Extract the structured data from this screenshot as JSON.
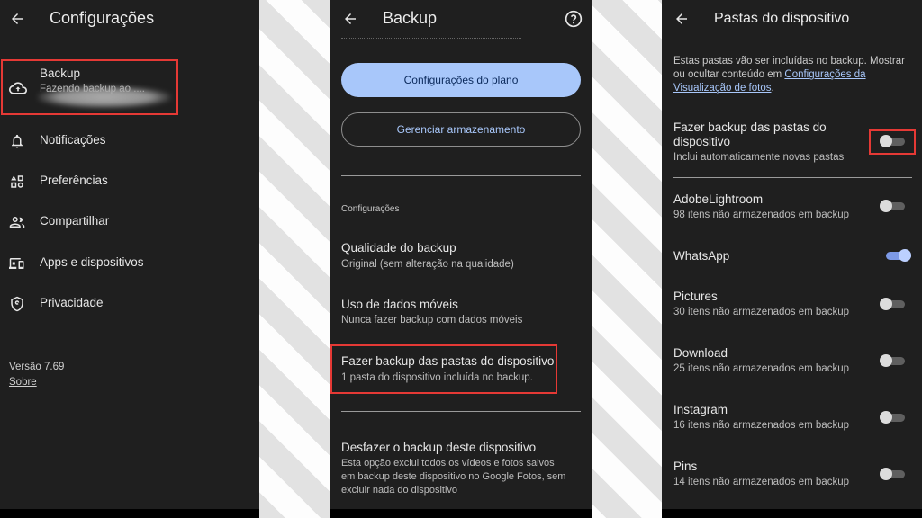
{
  "panel1": {
    "title": "Configurações",
    "backup": {
      "label": "Backup",
      "subtitle": "Fazendo backup ao ...."
    },
    "menu": [
      {
        "label": "Notificações",
        "icon": "bell-icon"
      },
      {
        "label": "Preferências",
        "icon": "preferences-icon"
      },
      {
        "label": "Compartilhar",
        "icon": "people-icon"
      },
      {
        "label": "Apps e dispositivos",
        "icon": "devices-icon"
      },
      {
        "label": "Privacidade",
        "icon": "privacy-shield-icon"
      }
    ],
    "version": "Versão 7.69",
    "about": "Sobre"
  },
  "panel2": {
    "title": "Backup",
    "plan_button": "Configurações do plano",
    "storage_button": "Gerenciar armazenamento",
    "section_header": "Configurações",
    "quality": {
      "title": "Qualidade do backup",
      "subtitle": "Original (sem alteração na qualidade)"
    },
    "mobile_data": {
      "title": "Uso de dados móveis",
      "subtitle": "Nunca fazer backup com dados móveis"
    },
    "device_folders": {
      "title": "Fazer backup das pastas do dispositivo",
      "subtitle": "1 pasta do dispositivo incluída no backup."
    },
    "undo": {
      "title": "Desfazer o backup deste dispositivo",
      "line1": "Esta opção exclui todos os vídeos e fotos salvos",
      "line2": "em backup deste dispositivo no Google Fotos, sem",
      "line3": "excluir nada do dispositivo"
    }
  },
  "panel3": {
    "title": "Pastas do dispositivo",
    "info_line1": "Estas pastas vão ser incluídas no backup. Mostrar",
    "info_line2_prefix": "ou ocultar conteúdo em ",
    "info_link1": "Configurações da",
    "info_link2": "Visualização de fotos",
    "info_suffix": ".",
    "master": {
      "title_line1": "Fazer backup das pastas do",
      "title_line2": "dispositivo",
      "subtitle": "Inclui automaticamente novas pastas",
      "enabled": false
    },
    "folders": [
      {
        "name": "AdobeLightroom",
        "subtitle": "98 itens não armazenados em backup",
        "enabled": false
      },
      {
        "name": "WhatsApp",
        "subtitle": "",
        "enabled": true
      },
      {
        "name": "Pictures",
        "subtitle": "30 itens não armazenados em backup",
        "enabled": false
      },
      {
        "name": "Download",
        "subtitle": "25 itens não armazenados em backup",
        "enabled": false
      },
      {
        "name": "Instagram",
        "subtitle": "16 itens não armazenados em backup",
        "enabled": false
      },
      {
        "name": "Pins",
        "subtitle": "14 itens não armazenados em backup",
        "enabled": false
      }
    ]
  },
  "colors": {
    "panel_bg": "#1f1f1f",
    "accent": "#a8c7fa",
    "highlight_box": "#e53935"
  }
}
